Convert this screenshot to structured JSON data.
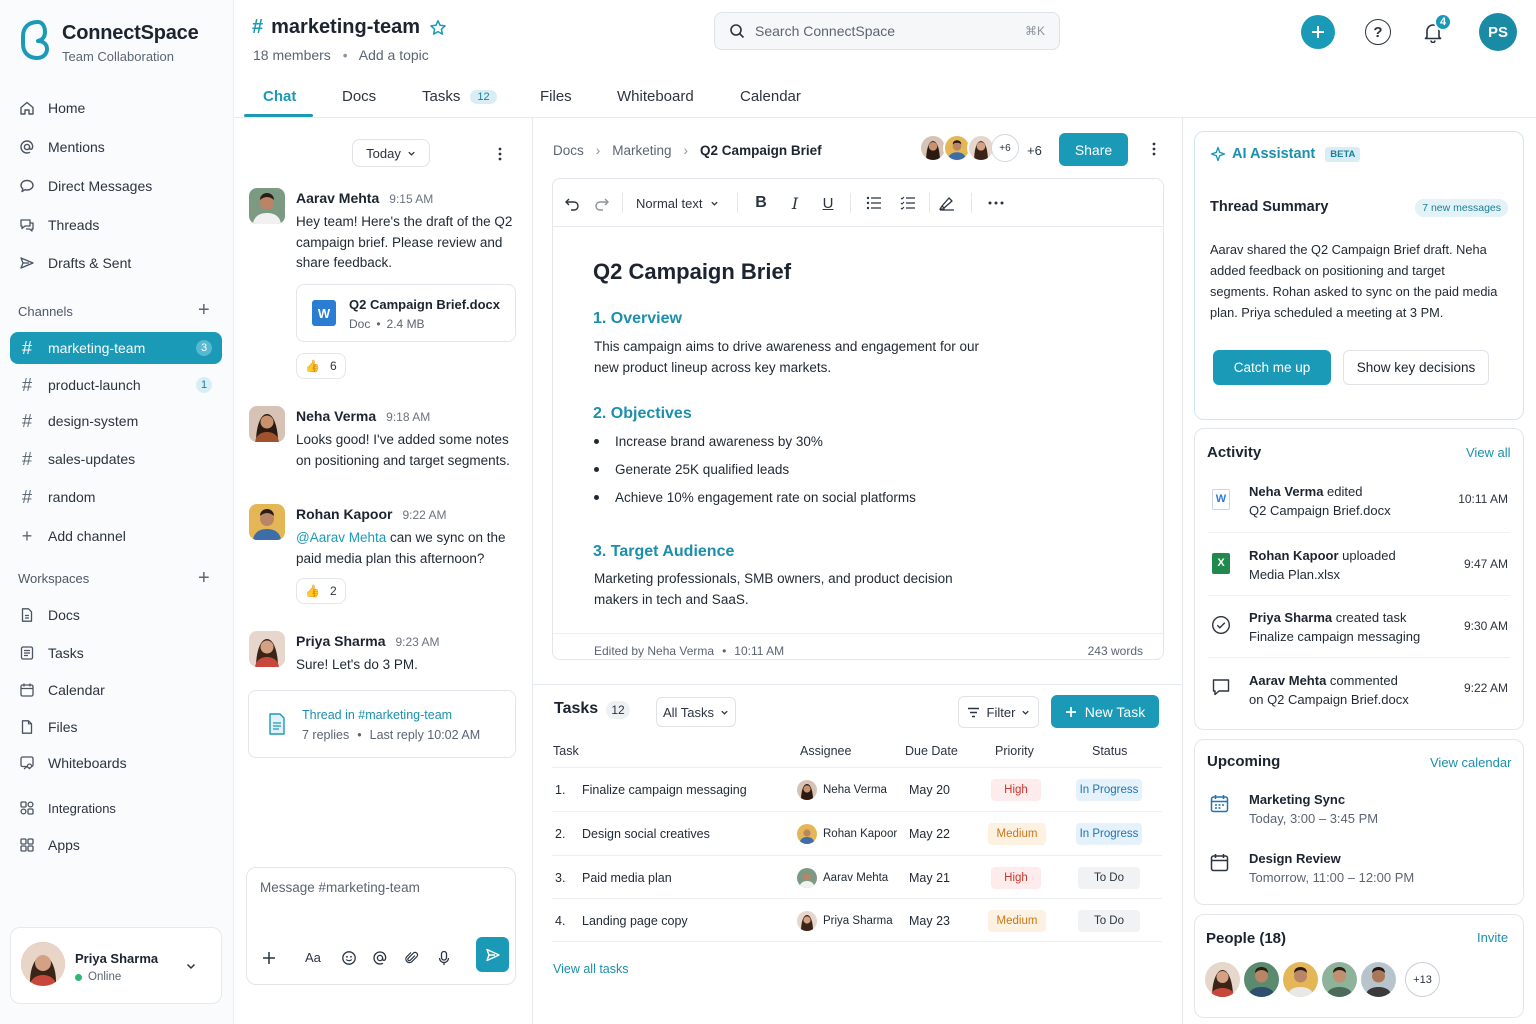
{
  "brand": {
    "name": "ConnectSpace",
    "subtitle": "Team Collaboration"
  },
  "sidebar": {
    "nav": [
      {
        "label": "Home",
        "icon": "home-icon"
      },
      {
        "label": "Mentions",
        "icon": "at-icon"
      },
      {
        "label": "Direct Messages",
        "icon": "chat-bubble-icon"
      },
      {
        "label": "Threads",
        "icon": "threads-icon"
      },
      {
        "label": "Drafts & Sent",
        "icon": "send-icon"
      }
    ],
    "channels_label": "Channels",
    "channels": [
      {
        "label": "marketing-team",
        "count": "3",
        "active": true
      },
      {
        "label": "product-launch",
        "count": "1"
      },
      {
        "label": "design-system"
      },
      {
        "label": "sales-updates"
      },
      {
        "label": "random"
      }
    ],
    "add_channel": "Add channel",
    "workspaces_label": "Workspaces",
    "workspaces": [
      {
        "label": "Docs",
        "icon": "doc-icon"
      },
      {
        "label": "Tasks",
        "icon": "tasks-icon"
      },
      {
        "label": "Calendar",
        "icon": "calendar-icon"
      },
      {
        "label": "Files",
        "icon": "file-icon"
      },
      {
        "label": "Whiteboards",
        "icon": "whiteboard-icon"
      }
    ],
    "extras": [
      {
        "label": "Integrations",
        "icon": "integrations-icon"
      },
      {
        "label": "Apps",
        "icon": "apps-icon"
      }
    ],
    "user": {
      "name": "Priya Sharma",
      "status": "Online"
    }
  },
  "header": {
    "channel": "marketing-team",
    "members": "18 members",
    "topic": "Add a topic",
    "search_placeholder": "Search ConnectSpace",
    "shortcut": "⌘K",
    "notif_count": "4",
    "user_initials": "PS",
    "tabs": [
      {
        "label": "Chat",
        "active": true
      },
      {
        "label": "Docs"
      },
      {
        "label": "Tasks",
        "count": "12"
      },
      {
        "label": "Files"
      },
      {
        "label": "Whiteboard"
      },
      {
        "label": "Calendar"
      }
    ]
  },
  "chat": {
    "date_filter": "Today",
    "messages": [
      {
        "name": "Aarav Mehta",
        "time": "9:15 AM",
        "text": "Hey team! Here's the draft of the Q2 campaign brief. Please review and share feedback."
      },
      {
        "name": "Neha Verma",
        "time": "9:18 AM",
        "text": "Looks good! I've added some notes on positioning and target segments."
      },
      {
        "name": "Rohan Kapoor",
        "time": "9:22 AM",
        "mention": "@Aarav Mehta",
        "text": " can we sync on the paid media plan this afternoon?"
      },
      {
        "name": "Priya Sharma",
        "time": "9:23 AM",
        "text": "Sure! Let's do 3 PM."
      }
    ],
    "attachment": {
      "name": "Q2 Campaign Brief.docx",
      "type": "Doc",
      "size": "2.4 MB"
    },
    "reactions": [
      {
        "emoji": "👍",
        "count": "6"
      },
      {
        "emoji": "👍",
        "count": "2"
      }
    ],
    "thread": {
      "title": "Thread in #marketing-team",
      "replies": "7 replies",
      "last_reply": "Last reply 10:02 AM"
    },
    "composer_placeholder": "Message #marketing-team",
    "format_label": "Aa"
  },
  "doc": {
    "breadcrumbs": [
      "Docs",
      "Marketing",
      "Q2 Campaign Brief"
    ],
    "collaborators_more": "+6",
    "collaborators_more_badge": "+6",
    "share": "Share",
    "text_style": "Normal text",
    "title": "Q2 Campaign Brief",
    "sections": [
      {
        "heading": "1. Overview",
        "body": "This campaign aims to drive awareness and engagement for our new product lineup across key markets."
      },
      {
        "heading": "2. Objectives",
        "bullets": [
          "Increase brand awareness by 30%",
          "Generate 25K qualified leads",
          "Achieve 10% engagement rate on social platforms"
        ]
      },
      {
        "heading": "3. Target Audience",
        "body": "Marketing professionals, SMB owners, and product decision makers in tech and SaaS."
      }
    ],
    "edited_by": "Edited by Neha Verma",
    "edited_time": "10:11 AM",
    "word_count": "243 words"
  },
  "tasks": {
    "title": "Tasks",
    "count": "12",
    "filter_all": "All Tasks",
    "filter": "Filter",
    "new_task": "New Task",
    "columns": [
      "Task",
      "Assignee",
      "Due Date",
      "Priority",
      "Status"
    ],
    "rows": [
      {
        "num": "1.",
        "task": "Finalize campaign messaging",
        "assignee": "Neha Verma",
        "due": "May 20",
        "priority": "High",
        "status": "In Progress"
      },
      {
        "num": "2.",
        "task": "Design social creatives",
        "assignee": "Rohan Kapoor",
        "due": "May 22",
        "priority": "Medium",
        "status": "In Progress"
      },
      {
        "num": "3.",
        "task": "Paid media plan",
        "assignee": "Aarav Mehta",
        "due": "May 21",
        "priority": "High",
        "status": "To Do"
      },
      {
        "num": "4.",
        "task": "Landing page copy",
        "assignee": "Priya Sharma",
        "due": "May 23",
        "priority": "Medium",
        "status": "To Do"
      }
    ],
    "view_all": "View all tasks"
  },
  "ai": {
    "title": "AI Assistant",
    "badge": "BETA",
    "summary_title": "Thread Summary",
    "new_messages": "7 new messages",
    "summary": "Aarav shared the Q2 Campaign Brief draft. Neha added feedback on positioning and target segments. Rohan asked to sync on the paid media plan. Priya scheduled a meeting at 3 PM.",
    "catch_up": "Catch me up",
    "key_decisions": "Show key decisions"
  },
  "activity": {
    "title": "Activity",
    "view_all": "View all",
    "items": [
      {
        "who": "Neha Verma",
        "action": " edited",
        "target": "Q2 Campaign Brief.docx",
        "time": "10:11 AM",
        "icon": "word-file-icon"
      },
      {
        "who": "Rohan Kapoor",
        "action": " uploaded",
        "target": "Media Plan.xlsx",
        "time": "9:47 AM",
        "icon": "excel-file-icon"
      },
      {
        "who": "Priya Sharma",
        "action": " created task",
        "target": "Finalize campaign messaging",
        "time": "9:30 AM",
        "icon": "check-circle-icon"
      },
      {
        "who": "Aarav Mehta",
        "action": " commented",
        "target": "on Q2 Campaign Brief.docx",
        "time": "9:22 AM",
        "icon": "comment-icon"
      }
    ]
  },
  "upcoming": {
    "title": "Upcoming",
    "view_calendar": "View calendar",
    "events": [
      {
        "name": "Marketing Sync",
        "time": "Today, 3:00 – 3:45 PM"
      },
      {
        "name": "Design Review",
        "time": "Tomorrow, 11:00 – 12:00 PM"
      }
    ]
  },
  "people": {
    "title": "People (18)",
    "invite": "Invite",
    "more": "+13"
  },
  "colors": {
    "accent": "#1b9ab8",
    "high": "#c8372d",
    "medium": "#c8771a",
    "in_progress": "#1f74b5"
  }
}
